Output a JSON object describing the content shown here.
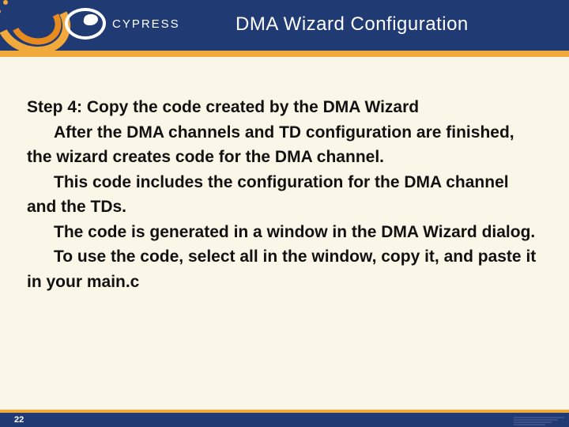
{
  "header": {
    "title": "DMA Wizard Configuration",
    "brand": "CYPRESS"
  },
  "content": {
    "step_heading": "Step 4: Copy the code created by the DMA Wizard",
    "p1": "After the DMA channels and TD configuration are finished, the wizard creates code for the DMA channel.",
    "p2": "This code includes the configuration for the DMA channel and the TDs.",
    "p3": "The code is generated in a window in the DMA Wizard dialog.",
    "p4": "To use the code, select all in the window, copy it, and paste it in your main.c"
  },
  "footer": {
    "page": "22"
  }
}
